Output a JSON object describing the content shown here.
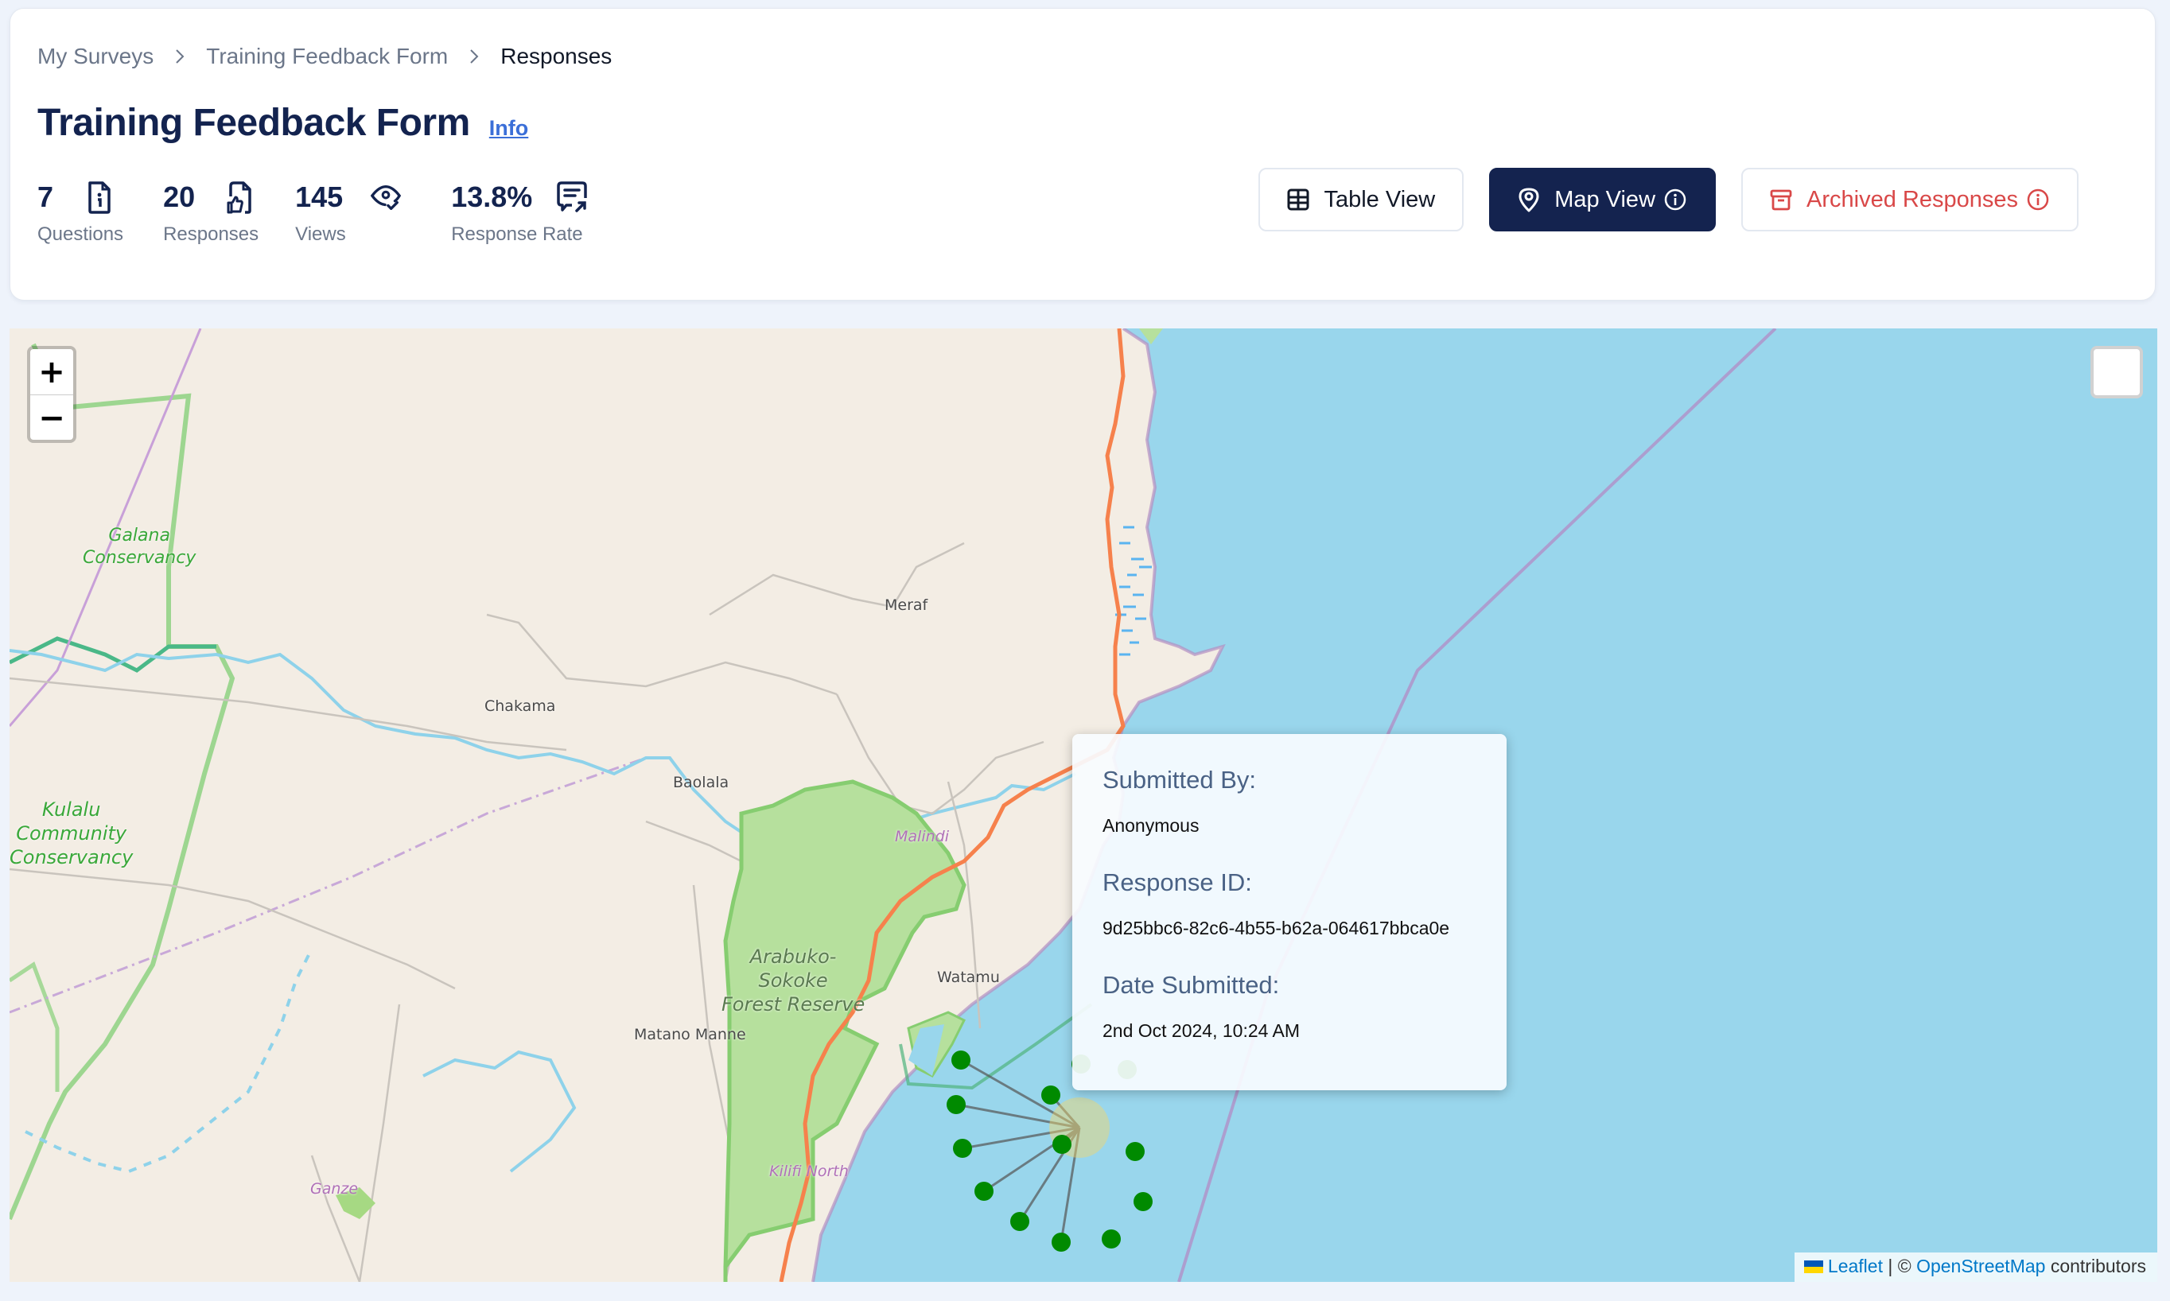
{
  "breadcrumb": [
    {
      "label": "My Surveys"
    },
    {
      "label": "Training Feedback Form"
    },
    {
      "label": "Responses"
    }
  ],
  "header": {
    "title": "Training Feedback Form",
    "info_link": "Info"
  },
  "stats": [
    {
      "value": "7",
      "label": "Questions",
      "icon": "file-info-icon"
    },
    {
      "value": "20",
      "label": "Responses",
      "icon": "file-thumbs-up-icon"
    },
    {
      "value": "145",
      "label": "Views",
      "icon": "eye-check-icon"
    },
    {
      "value": "13.8%",
      "label": "Response Rate",
      "icon": "message-arrow-icon"
    }
  ],
  "view_buttons": {
    "table": "Table View",
    "map": "Map View",
    "archived": "Archived Responses",
    "active": "map"
  },
  "colors": {
    "brand_navy": "#14234f",
    "danger": "#d94848",
    "link": "#3b6fd8",
    "marker": "#008a00"
  },
  "map": {
    "zoom_in": "+",
    "zoom_out": "−",
    "labels": {
      "galana": "Galana\nConservancy",
      "kulalu": "Kulalu\nCommunity\nConservancy",
      "meraf": "Meraf",
      "chakama": "Chakama",
      "baolala": "Baolala",
      "malindi": "Malindi",
      "arabuko": "Arabuko-\nSokoke\nForest Reserve",
      "watamu": "Watamu",
      "matano": "Matano Manne",
      "ganze": "Ganze",
      "kilifi": "Kilifi North"
    },
    "popup": {
      "submitted_by_label": "Submitted By:",
      "submitted_by": "Anonymous",
      "response_id_label": "Response ID:",
      "response_id": "9d25bbc6-82c6-4b55-b62a-064617bbca0e",
      "date_label": "Date Submitted:",
      "date": "2nd Oct 2024, 10:24 AM"
    },
    "attribution": {
      "leaflet": "Leaflet",
      "sep": " | © ",
      "osm": "OpenStreetMap",
      "contributors": " contributors"
    }
  }
}
